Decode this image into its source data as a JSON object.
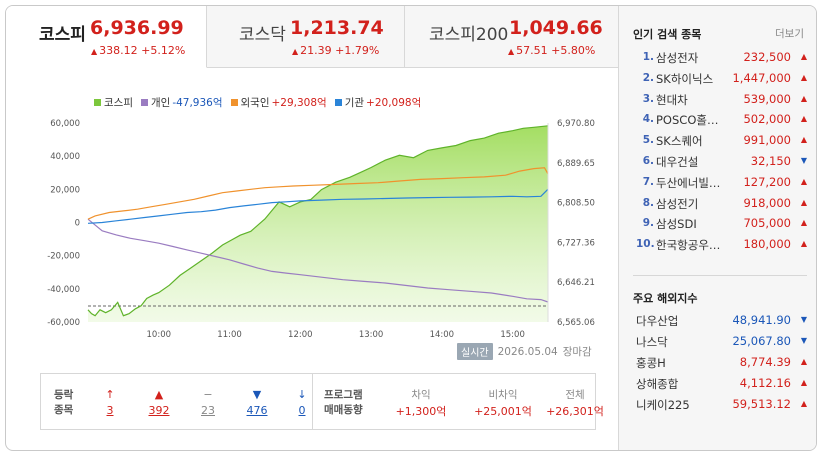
{
  "tabs": [
    {
      "name": "코스피",
      "value": "6,936.99",
      "change": "338.12 +5.12%",
      "active": true
    },
    {
      "name": "코스닥",
      "value": "1,213.74",
      "change": "21.39 +1.79%",
      "active": false
    },
    {
      "name": "코스피200",
      "value": "1,049.66",
      "change": "57.51 +5.80%",
      "active": false
    }
  ],
  "legend": {
    "kospi": {
      "label": "코스피",
      "value": ""
    },
    "individual": {
      "label": "개인",
      "value": "-47,936억"
    },
    "foreign": {
      "label": "외국인",
      "value": "+29,308억"
    },
    "institution": {
      "label": "기관",
      "value": "+20,098억"
    }
  },
  "colors": {
    "kospi": "#7cc73c",
    "individual": "#9a7cc1",
    "foreign": "#f0922d",
    "institution": "#2a84d8",
    "up": "#d2211c",
    "down": "#1b57b8"
  },
  "chart_data": {
    "type": "line",
    "left_axis": {
      "ticks": [
        60000,
        40000,
        20000,
        0,
        -20000,
        -40000,
        -60000
      ],
      "labels": [
        "60,000",
        "40,000",
        "20,000",
        "0",
        "-20,000",
        "-40,000",
        "-60,000"
      ],
      "range": [
        -60000,
        60000
      ]
    },
    "right_axis": {
      "labels": [
        "6,970.80",
        "6,889.65",
        "6,808.50",
        "6,727.36",
        "6,646.21",
        "6,565.06"
      ],
      "range": [
        6565.06,
        6970.8
      ]
    },
    "x_ticks": [
      "10:00",
      "11:00",
      "12:00",
      "13:00",
      "14:00",
      "15:00"
    ],
    "x_tick_hours": [
      10,
      11,
      12,
      13,
      14,
      15
    ],
    "x_range": [
      9.0,
      15.5
    ],
    "baseline_label": "",
    "series": [
      {
        "name": "코스피",
        "axis": "right",
        "x": [
          9.0,
          9.05,
          9.1,
          9.17,
          9.25,
          9.33,
          9.42,
          9.5,
          9.58,
          9.67,
          9.75,
          9.83,
          9.92,
          10.0,
          10.15,
          10.3,
          10.45,
          10.6,
          10.75,
          10.9,
          11.0,
          11.15,
          11.3,
          11.5,
          11.7,
          11.85,
          12.0,
          12.15,
          12.3,
          12.5,
          12.7,
          12.85,
          13.0,
          13.2,
          13.4,
          13.6,
          13.8,
          14.0,
          14.2,
          14.4,
          14.6,
          14.8,
          15.0,
          15.15,
          15.3,
          15.5
        ],
        "values": [
          6590,
          6582,
          6578,
          6590,
          6584,
          6590,
          6605,
          6578,
          6582,
          6592,
          6598,
          6613,
          6620,
          6625,
          6640,
          6660,
          6675,
          6690,
          6705,
          6722,
          6730,
          6742,
          6750,
          6775,
          6810,
          6800,
          6810,
          6815,
          6835,
          6850,
          6860,
          6870,
          6880,
          6895,
          6905,
          6900,
          6915,
          6920,
          6925,
          6935,
          6940,
          6950,
          6955,
          6960,
          6962,
          6965
        ]
      },
      {
        "name": "개인",
        "axis": "left",
        "x": [
          9.0,
          9.2,
          9.4,
          9.6,
          9.8,
          10.0,
          10.2,
          10.4,
          10.6,
          10.8,
          11.0,
          11.2,
          11.4,
          11.6,
          11.8,
          12.0,
          12.3,
          12.6,
          12.9,
          13.2,
          13.5,
          13.8,
          14.1,
          14.4,
          14.7,
          15.0,
          15.2,
          15.4,
          15.5
        ],
        "values": [
          2000,
          -5000,
          -7500,
          -9500,
          -11000,
          -12500,
          -14500,
          -16500,
          -18500,
          -20500,
          -22500,
          -25000,
          -27500,
          -29500,
          -30500,
          -31500,
          -33000,
          -34500,
          -35500,
          -36500,
          -38000,
          -39500,
          -40500,
          -41500,
          -42500,
          -44500,
          -46000,
          -46500,
          -47936
        ]
      },
      {
        "name": "외국인",
        "axis": "left",
        "x": [
          9.0,
          9.1,
          9.3,
          9.5,
          9.7,
          9.9,
          10.1,
          10.3,
          10.5,
          10.7,
          10.9,
          11.1,
          11.3,
          11.5,
          11.7,
          11.9,
          12.2,
          12.5,
          12.8,
          13.1,
          13.4,
          13.7,
          14.0,
          14.3,
          14.6,
          14.9,
          15.1,
          15.3,
          15.45,
          15.5
        ],
        "values": [
          2000,
          4000,
          6000,
          7000,
          8000,
          9500,
          11000,
          12500,
          14000,
          16000,
          18000,
          19000,
          20000,
          21000,
          21500,
          22000,
          22500,
          23000,
          23500,
          24000,
          25000,
          26000,
          26500,
          27000,
          27500,
          28500,
          31000,
          32500,
          33000,
          29308
        ]
      },
      {
        "name": "기관",
        "axis": "left",
        "x": [
          9.0,
          9.2,
          9.4,
          9.6,
          9.8,
          10.0,
          10.2,
          10.4,
          10.6,
          10.8,
          11.0,
          11.2,
          11.4,
          11.6,
          11.8,
          12.0,
          12.3,
          12.6,
          12.9,
          13.2,
          13.5,
          13.8,
          14.1,
          14.4,
          14.7,
          15.0,
          15.2,
          15.4,
          15.5
        ],
        "values": [
          -500,
          0,
          1000,
          2000,
          3000,
          4000,
          5000,
          6000,
          6500,
          7500,
          9000,
          10000,
          11000,
          12000,
          12500,
          13000,
          13500,
          14000,
          14200,
          14500,
          14800,
          15000,
          15200,
          15300,
          15500,
          15800,
          15500,
          15800,
          20098
        ]
      }
    ]
  },
  "status": {
    "live_label": "실시간",
    "date": "2026.05.04",
    "state": "장마감"
  },
  "advance": {
    "label_line1": "등락",
    "label_line2": "종목",
    "items": [
      {
        "icon": "↑",
        "count": "3",
        "color": "#d2211c"
      },
      {
        "icon": "▲",
        "count": "392",
        "color": "#d2211c"
      },
      {
        "icon": "−",
        "count": "23",
        "color": "#888888"
      },
      {
        "icon": "▼",
        "count": "476",
        "color": "#1b57b8"
      },
      {
        "icon": "↓",
        "count": "0",
        "color": "#1b57b8"
      }
    ]
  },
  "program": {
    "label_line1": "프로그램",
    "label_line2": "매매동향",
    "cols": [
      {
        "head": "차익",
        "value": "+1,300억"
      },
      {
        "head": "비차익",
        "value": "+25,001억"
      },
      {
        "head": "전체",
        "value": "+26,301억"
      }
    ]
  },
  "popular": {
    "title": "인기 검색 종목",
    "more": "더보기",
    "items": [
      {
        "rank": "1.",
        "name": "삼성전자",
        "price": "232,500",
        "dir": "up"
      },
      {
        "rank": "2.",
        "name": "SK하이닉스",
        "price": "1,447,000",
        "dir": "up"
      },
      {
        "rank": "3.",
        "name": "현대차",
        "price": "539,000",
        "dir": "up"
      },
      {
        "rank": "4.",
        "name": "POSCO홀…",
        "price": "502,000",
        "dir": "up"
      },
      {
        "rank": "5.",
        "name": "SK스퀘어",
        "price": "991,000",
        "dir": "up"
      },
      {
        "rank": "6.",
        "name": "대우건설",
        "price": "32,150",
        "dir": "down"
      },
      {
        "rank": "7.",
        "name": "두산에너빌…",
        "price": "127,200",
        "dir": "up"
      },
      {
        "rank": "8.",
        "name": "삼성전기",
        "price": "918,000",
        "dir": "up"
      },
      {
        "rank": "9.",
        "name": "삼성SDI",
        "price": "705,000",
        "dir": "up"
      },
      {
        "rank": "10.",
        "name": "한국항공우…",
        "price": "180,000",
        "dir": "up"
      }
    ]
  },
  "intl": {
    "title": "주요 해외지수",
    "items": [
      {
        "name": "다우산업",
        "price": "48,941.90",
        "dir": "down"
      },
      {
        "name": "나스닥",
        "price": "25,067.80",
        "dir": "down"
      },
      {
        "name": "홍콩H",
        "price": "8,774.39",
        "dir": "up"
      },
      {
        "name": "상해종합",
        "price": "4,112.16",
        "dir": "up"
      },
      {
        "name": "니케이225",
        "price": "59,513.12",
        "dir": "up"
      }
    ]
  }
}
